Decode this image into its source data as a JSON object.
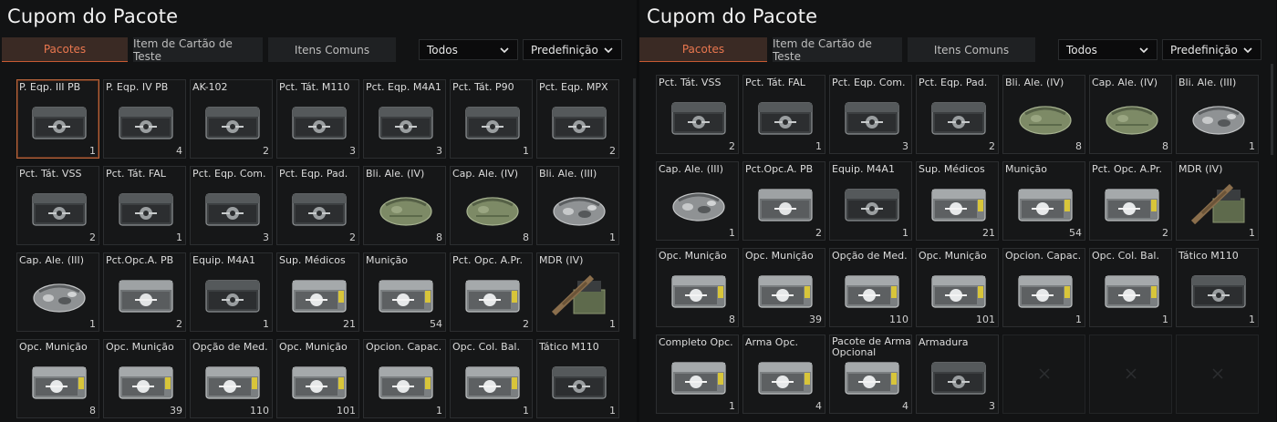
{
  "title": "Cupom do Pacote",
  "tabs": [
    "Pacotes",
    "Item de Cartão de Teste",
    "Itens Comuns"
  ],
  "filter": "Todos",
  "sort": "Predefinição",
  "colors": {
    "accent": "#e9774f",
    "active_tab_bg": "#3a2a24"
  },
  "left_panel": {
    "items": [
      {
        "name": "P. Eqp. III PB",
        "qty": "1",
        "icon": "case-dark-icon",
        "selected": true
      },
      {
        "name": "P. Eqp. IV PB",
        "qty": "4",
        "icon": "case-dark-icon"
      },
      {
        "name": "AK-102",
        "qty": "2",
        "icon": "case-dark-icon"
      },
      {
        "name": "Pct. Tát. M110",
        "qty": "3",
        "icon": "case-dark-icon"
      },
      {
        "name": "Pct. Eqp. M4A1",
        "qty": "3",
        "icon": "case-dark-icon"
      },
      {
        "name": "Pct. Tát. P90",
        "qty": "1",
        "icon": "case-dark-icon"
      },
      {
        "name": "Pct. Eqp. MPX",
        "qty": "2",
        "icon": "case-dark-icon"
      },
      {
        "name": "Pct. Tát. VSS",
        "qty": "2",
        "icon": "case-dark-icon"
      },
      {
        "name": "Pct. Tát. FAL",
        "qty": "1",
        "icon": "case-dark-icon"
      },
      {
        "name": "Pct. Eqp. Com.",
        "qty": "3",
        "icon": "case-dark-icon"
      },
      {
        "name": "Pct. Eqp. Pad.",
        "qty": "2",
        "icon": "case-dark-icon"
      },
      {
        "name": "Bli. Ale. (IV)",
        "qty": "8",
        "icon": "bag-green-icon"
      },
      {
        "name": "Cap. Ale. (IV)",
        "qty": "8",
        "icon": "bag-green-icon"
      },
      {
        "name": "Bli. Ale. (III)",
        "qty": "1",
        "icon": "bag-camo-icon"
      },
      {
        "name": "Cap. Ale. (III)",
        "qty": "1",
        "icon": "bag-camo-icon"
      },
      {
        "name": "Pct.Opc.A. PB",
        "qty": "2",
        "icon": "case-light-icon"
      },
      {
        "name": "Equip. M4A1",
        "qty": "1",
        "icon": "case-dark-icon"
      },
      {
        "name": "Sup. Médicos",
        "qty": "21",
        "icon": "case-yellow-icon"
      },
      {
        "name": "Munição",
        "qty": "54",
        "icon": "case-yellow-icon"
      },
      {
        "name": "Pct. Opc. A.Pr.",
        "qty": "2",
        "icon": "case-yellow-icon"
      },
      {
        "name": "MDR (IV)",
        "qty": "1",
        "icon": "rifle-crate-icon"
      },
      {
        "name": "Opc. Munição",
        "qty": "8",
        "icon": "case-yellow-icon"
      },
      {
        "name": "Opc. Munição",
        "qty": "39",
        "icon": "case-yellow-icon"
      },
      {
        "name": "Opção de Med.",
        "qty": "110",
        "icon": "case-yellow-icon"
      },
      {
        "name": "Opc. Munição",
        "qty": "101",
        "icon": "case-yellow-icon"
      },
      {
        "name": "Opcion. Capac.",
        "qty": "1",
        "icon": "case-yellow-icon"
      },
      {
        "name": "Opc. Col. Bal.",
        "qty": "1",
        "icon": "case-yellow-icon"
      },
      {
        "name": "Tático M110",
        "qty": "1",
        "icon": "case-dark-icon"
      }
    ]
  },
  "right_panel": {
    "items": [
      {
        "name": "Pct. Tát. VSS",
        "qty": "2",
        "icon": "case-dark-icon"
      },
      {
        "name": "Pct. Tát. FAL",
        "qty": "1",
        "icon": "case-dark-icon"
      },
      {
        "name": "Pct. Eqp. Com.",
        "qty": "3",
        "icon": "case-dark-icon"
      },
      {
        "name": "Pct. Eqp. Pad.",
        "qty": "2",
        "icon": "case-dark-icon"
      },
      {
        "name": "Bli. Ale. (IV)",
        "qty": "8",
        "icon": "bag-green-icon"
      },
      {
        "name": "Cap. Ale. (IV)",
        "qty": "8",
        "icon": "bag-green-icon"
      },
      {
        "name": "Bli. Ale. (III)",
        "qty": "1",
        "icon": "bag-camo-icon"
      },
      {
        "name": "Cap. Ale. (III)",
        "qty": "1",
        "icon": "bag-camo-icon"
      },
      {
        "name": "Pct.Opc.A. PB",
        "qty": "2",
        "icon": "case-light-icon"
      },
      {
        "name": "Equip. M4A1",
        "qty": "1",
        "icon": "case-dark-icon"
      },
      {
        "name": "Sup. Médicos",
        "qty": "21",
        "icon": "case-yellow-icon"
      },
      {
        "name": "Munição",
        "qty": "54",
        "icon": "case-yellow-icon"
      },
      {
        "name": "Pct. Opc. A.Pr.",
        "qty": "2",
        "icon": "case-yellow-icon"
      },
      {
        "name": "MDR (IV)",
        "qty": "1",
        "icon": "rifle-crate-icon"
      },
      {
        "name": "Opc. Munição",
        "qty": "8",
        "icon": "case-yellow-icon"
      },
      {
        "name": "Opc. Munição",
        "qty": "39",
        "icon": "case-yellow-icon"
      },
      {
        "name": "Opção de Med.",
        "qty": "110",
        "icon": "case-yellow-icon"
      },
      {
        "name": "Opc. Munição",
        "qty": "101",
        "icon": "case-yellow-icon"
      },
      {
        "name": "Opcion. Capac.",
        "qty": "1",
        "icon": "case-yellow-icon"
      },
      {
        "name": "Opc. Col. Bal.",
        "qty": "1",
        "icon": "case-yellow-icon"
      },
      {
        "name": "Tático M110",
        "qty": "1",
        "icon": "case-dark-icon"
      },
      {
        "name": "Completo Opc.",
        "qty": "1",
        "icon": "case-yellow-icon"
      },
      {
        "name": "Arma Opc.",
        "qty": "4",
        "icon": "case-yellow-icon"
      },
      {
        "name": "Pacote de Arma Opcional",
        "qty": "4",
        "icon": "case-yellow-icon"
      },
      {
        "name": "Armadura",
        "qty": "3",
        "icon": "case-dark-icon"
      },
      {
        "name": "",
        "qty": "",
        "icon": "empty-slot-icon",
        "empty": true
      },
      {
        "name": "",
        "qty": "",
        "icon": "empty-slot-icon",
        "empty": true
      },
      {
        "name": "",
        "qty": "",
        "icon": "empty-slot-icon",
        "empty": true
      }
    ]
  }
}
